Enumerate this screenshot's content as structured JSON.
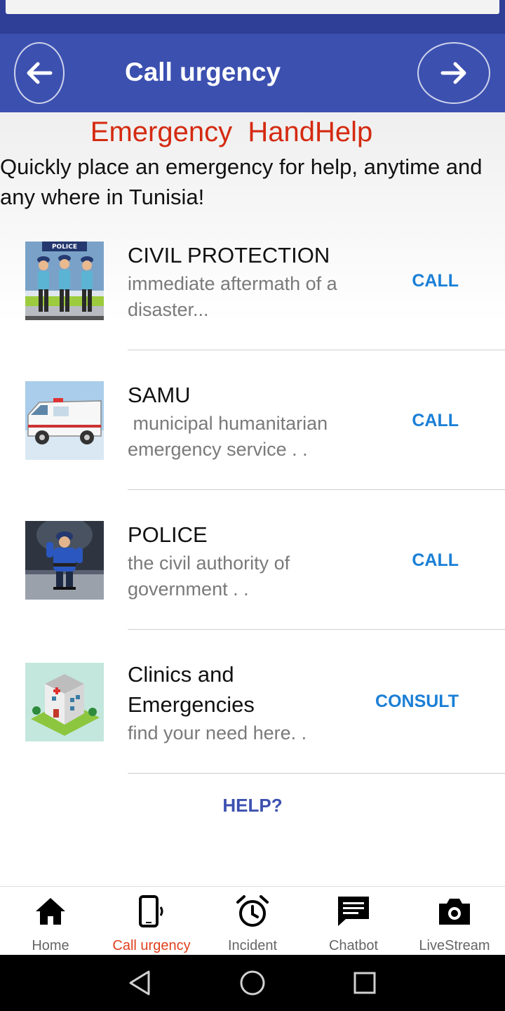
{
  "header": {
    "title": "Call urgency"
  },
  "brand": "Emergency  HandHelp",
  "intro": "Quickly place an emergency  for help, anytime and any where in Tunisia!",
  "services": [
    {
      "title": "CIVIL PROTECTION",
      "description": "immediate aftermath of a disaster...",
      "action": "CALL",
      "image_label": "POLICE"
    },
    {
      "title": "SAMU",
      "description": " municipal humanitarian emergency service . .",
      "action": "CALL"
    },
    {
      "title": "POLICE",
      "description": "the civil authority of government . .",
      "action": "CALL"
    },
    {
      "title": "Clinics and Emergencies",
      "description": "find your need here. .",
      "action": "CONSULT"
    }
  ],
  "help_label": "HELP?",
  "bottom_nav": [
    {
      "label": "Home",
      "icon": "home-icon"
    },
    {
      "label": "Call urgency",
      "icon": "phone-ringing-icon",
      "active": true
    },
    {
      "label": "Incident",
      "icon": "alarm-clock-icon"
    },
    {
      "label": "Chatbot",
      "icon": "chat-icon"
    },
    {
      "label": "LiveStream",
      "icon": "camera-icon"
    }
  ],
  "colors": {
    "primary": "#3c50b0",
    "brand_red": "#d42a10",
    "action_blue": "#1a7fd6",
    "active_tab": "#e0401c"
  }
}
